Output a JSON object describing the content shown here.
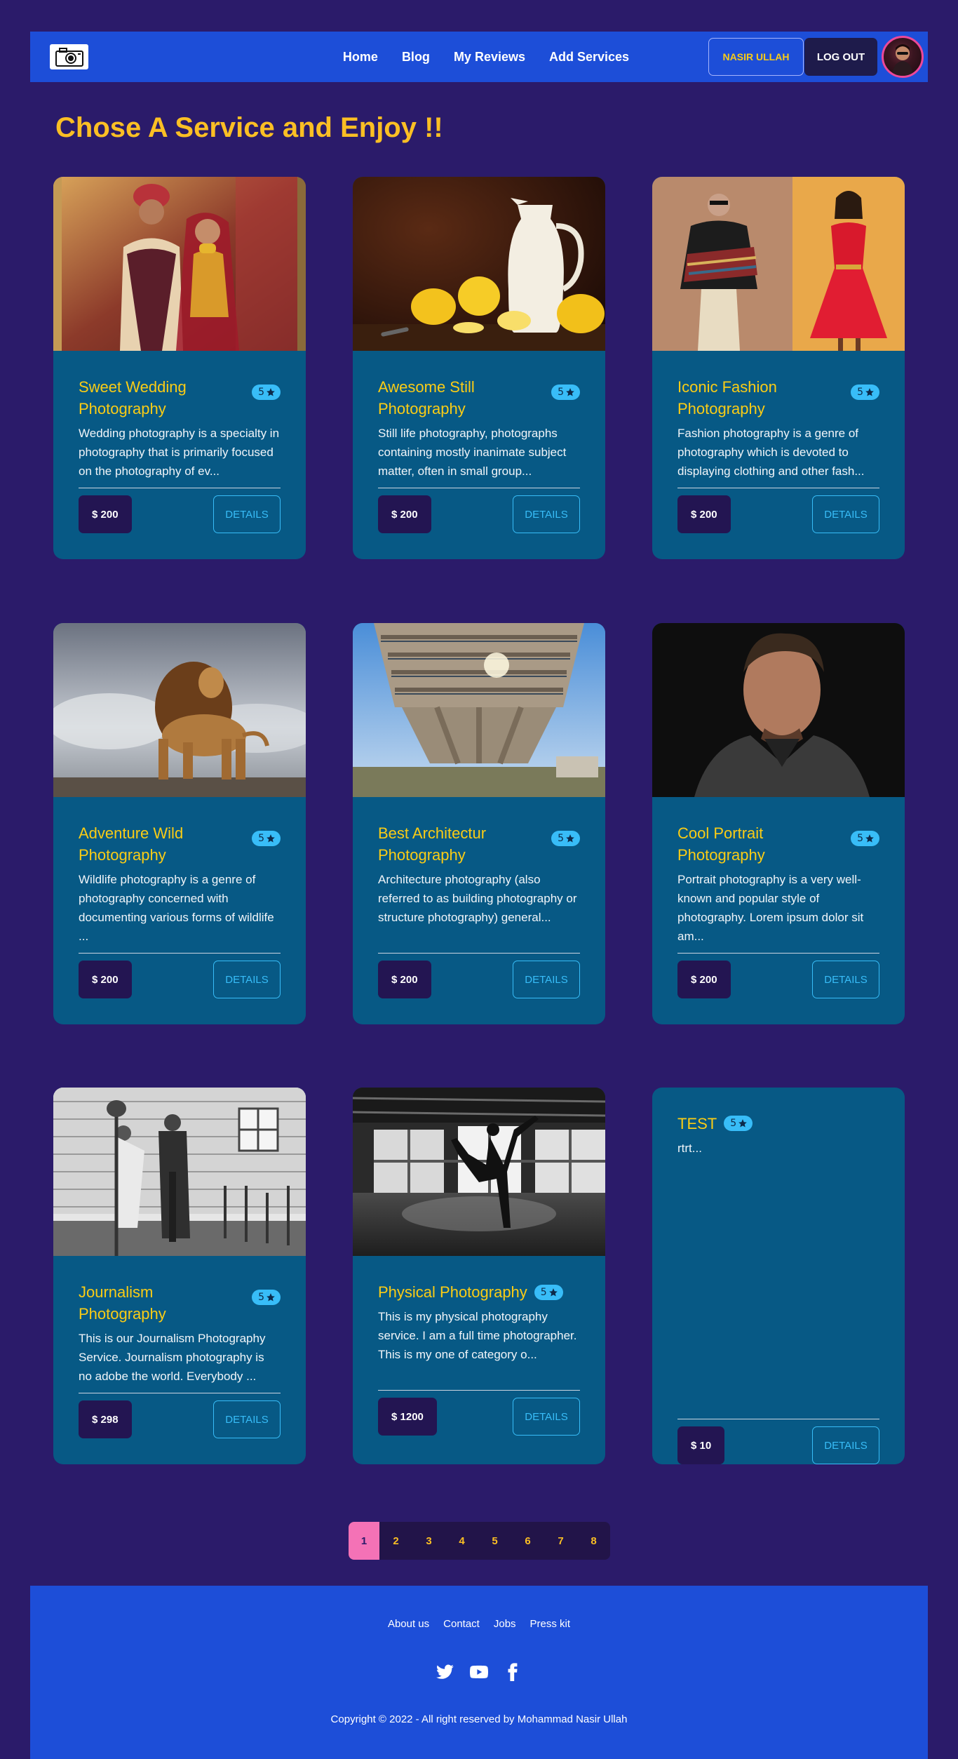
{
  "nav": {
    "links": [
      "Home",
      "Blog",
      "My Reviews",
      "Add Services"
    ],
    "user_name": "NASIR ULLAH",
    "logout_label": "LOG OUT"
  },
  "page_title": "Chose A Service and Enjoy !!",
  "services": [
    {
      "title": "Sweet Wedding Photography",
      "rating": "5",
      "description": "Wedding photography is a specialty in photography that is primarily focused on the photography of ev...",
      "price": "$ 200",
      "details_label": "DETAILS",
      "image": "wedding-couple"
    },
    {
      "title": "Awesome Still Photography",
      "rating": "5",
      "description": "Still life photography, photographs containing mostly inanimate subject matter, often in small group...",
      "price": "$ 200",
      "details_label": "DETAILS",
      "image": "pitcher-lemons"
    },
    {
      "title": "Iconic Fashion Photography",
      "rating": "5",
      "description": "Fashion photography is a genre of photography which is devoted to displaying clothing and other fash...",
      "price": "$ 200",
      "details_label": "DETAILS",
      "image": "fashion-models"
    },
    {
      "title": "Adventure Wild Photography",
      "rating": "5",
      "description": "Wildlife photography is a genre of photography concerned with documenting various forms of wildlife ...",
      "price": "$ 200",
      "details_label": "DETAILS",
      "image": "lion"
    },
    {
      "title": "Best Architectur Photography",
      "rating": "5",
      "description": "Architecture photography (also referred to as building photography or structure photography) general...",
      "price": "$ 200",
      "details_label": "DETAILS",
      "image": "building"
    },
    {
      "title": "Cool Portrait Photography",
      "rating": "5",
      "description": "Portrait photography is a very well-known and popular style of photography. Lorem ipsum dolor sit am...",
      "price": "$ 200",
      "details_label": "DETAILS",
      "image": "portrait-man"
    },
    {
      "title": "Journalism Photography",
      "rating": "5",
      "description": "This is our Journalism Photography Service. Journalism photography is no adobe the world. Everybody ...",
      "price": "$ 298",
      "details_label": "DETAILS",
      "image": "journalism-bw"
    },
    {
      "title": "Physical Photography",
      "rating": "5",
      "description": "This is my physical photography service. I am a full time photographer. This is my one of category o...",
      "price": "$ 1200",
      "details_label": "DETAILS",
      "image": "dancer-bw"
    },
    {
      "title": "TEST",
      "rating": "5",
      "description": "rtrt...",
      "price": "$ 10",
      "details_label": "DETAILS",
      "image": ""
    }
  ],
  "pagination": [
    "1",
    "2",
    "3",
    "4",
    "5",
    "6",
    "7",
    "8"
  ],
  "pagination_active": "1",
  "footer": {
    "links": [
      "About us",
      "Contact",
      "Jobs",
      "Press kit"
    ],
    "social_icons": [
      "twitter-icon",
      "youtube-icon",
      "facebook-icon"
    ],
    "copyright": "Copyright © 2022 - All right reserved by Mohammad Nasir Ullah"
  },
  "colors": {
    "background": "#2b1b6a",
    "navbar": "#1d4ed8",
    "card": "#075985",
    "accent_yellow": "#facc15",
    "accent_blue": "#38bdf8",
    "pagination_active": "#f472b6"
  }
}
